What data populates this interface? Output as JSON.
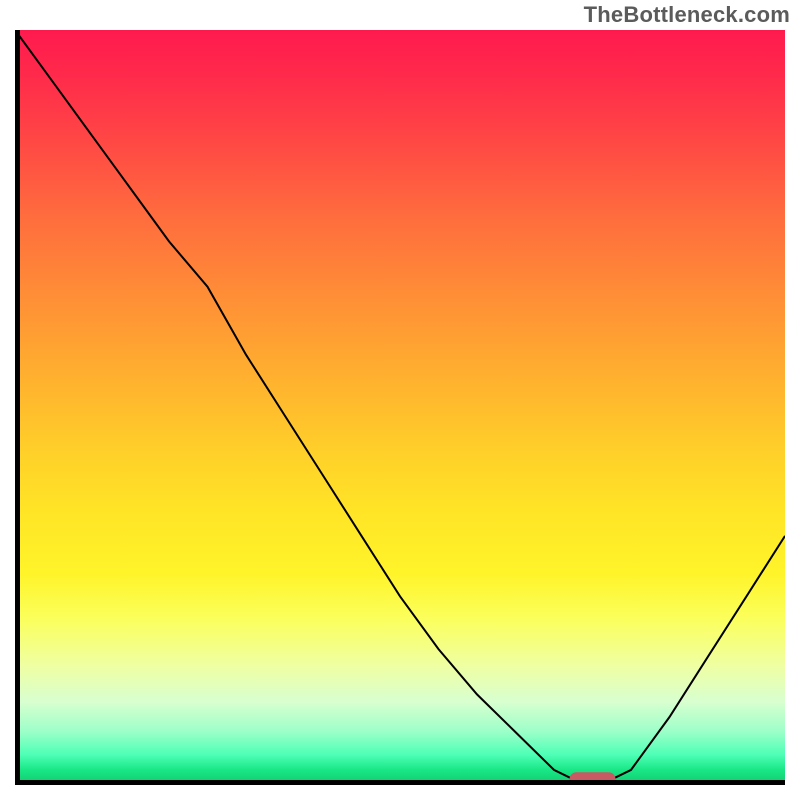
{
  "watermark": "TheBottleneck.com",
  "colors": {
    "watermark_text": "#5b5b5b",
    "curve": "#000000",
    "axis": "#000000",
    "marker": "#c75a63",
    "gradient_top": "#ff1a4e",
    "gradient_bottom": "#10c96e"
  },
  "chart_data": {
    "type": "line",
    "title": "",
    "xlabel": "",
    "ylabel": "",
    "xlim": [
      0,
      100
    ],
    "ylim": [
      0,
      100
    ],
    "x": [
      0,
      5,
      10,
      15,
      20,
      25,
      30,
      35,
      40,
      45,
      50,
      55,
      60,
      65,
      70,
      73,
      77,
      80,
      85,
      90,
      95,
      100
    ],
    "values": [
      100,
      93,
      86,
      79,
      72,
      66,
      57,
      49,
      41,
      33,
      25,
      18,
      12,
      7,
      2,
      0.5,
      0.5,
      2,
      9,
      17,
      25,
      33
    ],
    "marker": {
      "x": 75,
      "y": 0.5,
      "color": "#c75a63",
      "shape": "pill"
    },
    "background_gradient": {
      "direction": "top-to-bottom",
      "stops": [
        {
          "pos": 0.0,
          "color": "#ff1a4e"
        },
        {
          "pos": 0.14,
          "color": "#ff4545"
        },
        {
          "pos": 0.34,
          "color": "#ff8a37"
        },
        {
          "pos": 0.56,
          "color": "#ffd029"
        },
        {
          "pos": 0.72,
          "color": "#fff42a"
        },
        {
          "pos": 0.84,
          "color": "#f0ffa0"
        },
        {
          "pos": 0.93,
          "color": "#9affc8"
        },
        {
          "pos": 1.0,
          "color": "#10c96e"
        }
      ]
    }
  }
}
